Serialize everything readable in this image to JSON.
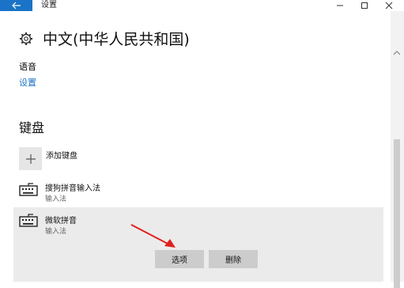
{
  "window": {
    "title": "设置"
  },
  "page": {
    "title": "中文(中华人民共和国)"
  },
  "language": {
    "label": "语音",
    "link": "设置"
  },
  "keyboard": {
    "heading": "键盘",
    "add_label": "添加键盘",
    "items": [
      {
        "name": "搜狗拼音输入法",
        "type": "输入法"
      },
      {
        "name": "微软拼音",
        "type": "输入法"
      }
    ]
  },
  "buttons": {
    "options": "选项",
    "delete": "删除"
  },
  "colors": {
    "accent": "#1a73c6",
    "annotation_arrow": "#e02020"
  },
  "icons": [
    "back-arrow-icon",
    "minimize-icon",
    "maximize-icon",
    "close-icon",
    "gear-icon",
    "plus-icon",
    "keyboard-icon"
  ]
}
